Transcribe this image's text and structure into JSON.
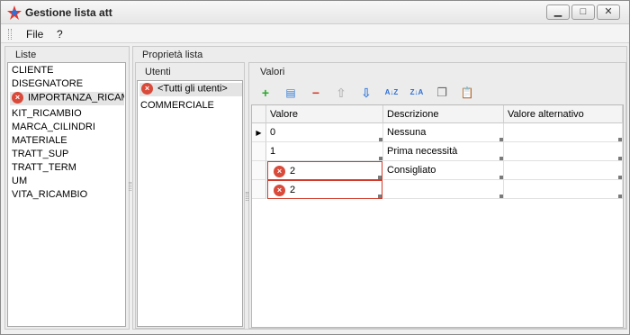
{
  "window": {
    "title": "Gestione lista att"
  },
  "menu": {
    "items": [
      "File",
      "?"
    ]
  },
  "liste": {
    "title": "Liste",
    "items": [
      "CLIENTE",
      "DISEGNATORE",
      "IMPORTANZA_RICAMBIO",
      "KIT_RICAMBIO",
      "MARCA_CILINDRI",
      "MATERIALE",
      "TRATT_SUP",
      "TRATT_TERM",
      "UM",
      "VITA_RICAMBIO"
    ]
  },
  "proprieta": {
    "title": "Proprietà lista"
  },
  "utenti": {
    "title": "Utenti",
    "items": [
      "<Tutti gli utenti>",
      "COMMERCIALE"
    ]
  },
  "valori": {
    "title": "Valori",
    "columns": [
      "Valore",
      "Descrizione",
      "Valore alternativo"
    ],
    "rows": [
      [
        "0",
        "Nessuna",
        ""
      ],
      [
        "1",
        "Prima necessità",
        ""
      ],
      [
        "2",
        "Consigliato",
        ""
      ],
      [
        "2",
        "",
        ""
      ]
    ]
  },
  "toolbar": {
    "add": "+",
    "add_row": "▤",
    "remove": "−",
    "up": "⇧",
    "down": "⇩",
    "sort_az": "A↓Z",
    "sort_za": "Z↓A",
    "copy": "❐",
    "paste": "📋"
  },
  "icons": {
    "error": "×",
    "row_current": "▶"
  },
  "colors": {
    "error": "#d94a3a",
    "add": "#2fa82f",
    "remove": "#d23a2a",
    "arrow_down": "#3a7fd8"
  }
}
